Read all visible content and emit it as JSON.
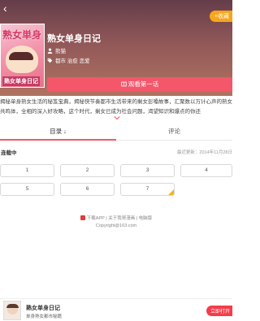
{
  "header": {
    "back_glyph": "‹",
    "collect_label": "+收藏"
  },
  "comic": {
    "cover_text_top": "熟女単身",
    "cover_text_bottom": "熟女单身日记",
    "title": "熟女单身日记",
    "author": "熊猫",
    "tags": "都市 治愈 恋爱",
    "read_button": "观看第一话",
    "description": "揭秘单身熟女生活的秘笈宝典，揭秘快节奏都市生活带来的剩女彭嗓故事，汇聚数以万计心声的熟女共鸣体，全相的深入好攻略，这个时代，剩女已成为社会问题，渴望知识和爆点的你还"
  },
  "tabs": [
    {
      "label": "目录 ↓"
    },
    {
      "label": "评论"
    }
  ],
  "chapters_section": {
    "title": "连载中",
    "updated": "最近更新：2014年11月28日",
    "chapters": [
      "1",
      "2",
      "3",
      "4",
      "5",
      "6",
      "7"
    ]
  },
  "footer": {
    "links": "下载APP | 关于我哥漫画 | 电脑版",
    "copyright": "Copyright@163.com"
  },
  "bottom_bar": {
    "name": "熟女单身日记",
    "subtitle": "单身熟女都市秘籍",
    "open_button": "立即打开"
  },
  "colors": {
    "accent": "#f4566a",
    "collect": "#f7a51c",
    "open_button": "#f43d4a"
  }
}
